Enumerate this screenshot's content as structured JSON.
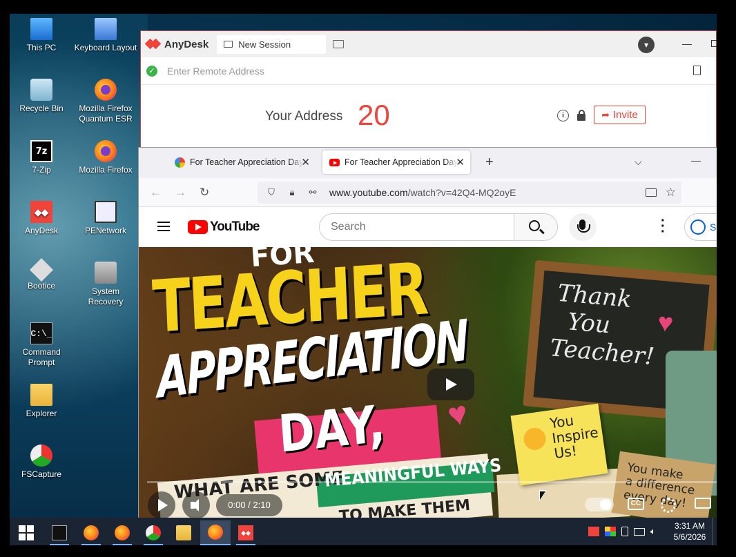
{
  "desktop": {
    "icons": [
      {
        "label": "This PC",
        "icon": "computer-icon"
      },
      {
        "label": "Keyboard Layout",
        "icon": "keyboard-icon"
      },
      {
        "label": "Recycle Bin",
        "icon": "recycle-bin-icon"
      },
      {
        "label": "Mozilla Firefox Quantum ESR",
        "icon": "firefox-icon"
      },
      {
        "label": "7-Zip",
        "icon": "seven-zip-icon"
      },
      {
        "label": "Mozilla Firefox",
        "icon": "firefox-icon"
      },
      {
        "label": "AnyDesk",
        "icon": "anydesk-icon"
      },
      {
        "label": "PENetwork",
        "icon": "network-icon"
      },
      {
        "label": "Bootice",
        "icon": "bootice-icon"
      },
      {
        "label": "System Recovery",
        "icon": "system-recovery-icon"
      },
      {
        "label": "Command Prompt",
        "icon": "command-prompt-icon"
      },
      {
        "label": "Explorer",
        "icon": "folder-icon"
      },
      {
        "label": "FSCapture",
        "icon": "fscapture-icon"
      }
    ]
  },
  "anydesk": {
    "app_name": "AnyDesk",
    "tab_label": "New Session",
    "address_placeholder": "Enter Remote Address",
    "your_address_label": "Your Address",
    "your_address_value": "20",
    "invite_label": "Invite",
    "info_glyph": "i",
    "status_color": "#3bb34a",
    "accent_color": "#ef443b"
  },
  "firefox": {
    "tabs": [
      {
        "title": "For Teacher Appreciation Day, wh",
        "favicon": "google-icon"
      },
      {
        "title": "For Teacher Appreciation Day, wh",
        "favicon": "youtube-icon",
        "active": true
      }
    ],
    "url_host": "www.youtube.com",
    "url_path": "/watch?v=42Q4-MQ2oyE"
  },
  "youtube": {
    "logo_text": "YouTube",
    "search_placeholder": "Search",
    "signin_label": "S",
    "video": {
      "thumb_for": "FOR",
      "thumb_title_1": "TEACHER",
      "thumb_title_2": "APPRECIATION",
      "thumb_title_3": "DAY,",
      "thumb_sub_1": "WHAT ARE SOME",
      "thumb_sub_2": "MEANINGFUL WAYS",
      "thumb_sub_3": "TO MAKE THEM",
      "chalk_1": "Thank",
      "chalk_2": "You",
      "chalk_3": "Teacher!",
      "note_1": "You",
      "note_2": "Inspire",
      "note_3": "Us!",
      "tag_1": "You make",
      "tag_2": "a difference",
      "tag_3": "every day!",
      "time": "0:00 / 2:10",
      "progress_fraction": 0.0,
      "cc_label": "CC"
    }
  },
  "taskbar": {
    "apps": [
      {
        "name": "start",
        "icon": "windows-start-icon"
      },
      {
        "name": "command-prompt",
        "icon": "command-prompt-icon"
      },
      {
        "name": "firefox-1",
        "icon": "firefox-icon"
      },
      {
        "name": "firefox-2",
        "icon": "firefox-icon"
      },
      {
        "name": "fscapture",
        "icon": "fscapture-icon"
      },
      {
        "name": "explorer",
        "icon": "folder-icon"
      },
      {
        "name": "firefox-active",
        "icon": "firefox-icon"
      },
      {
        "name": "anydesk",
        "icon": "anydesk-icon"
      }
    ],
    "time": "3:31 AM",
    "date": "5/6/2026"
  }
}
